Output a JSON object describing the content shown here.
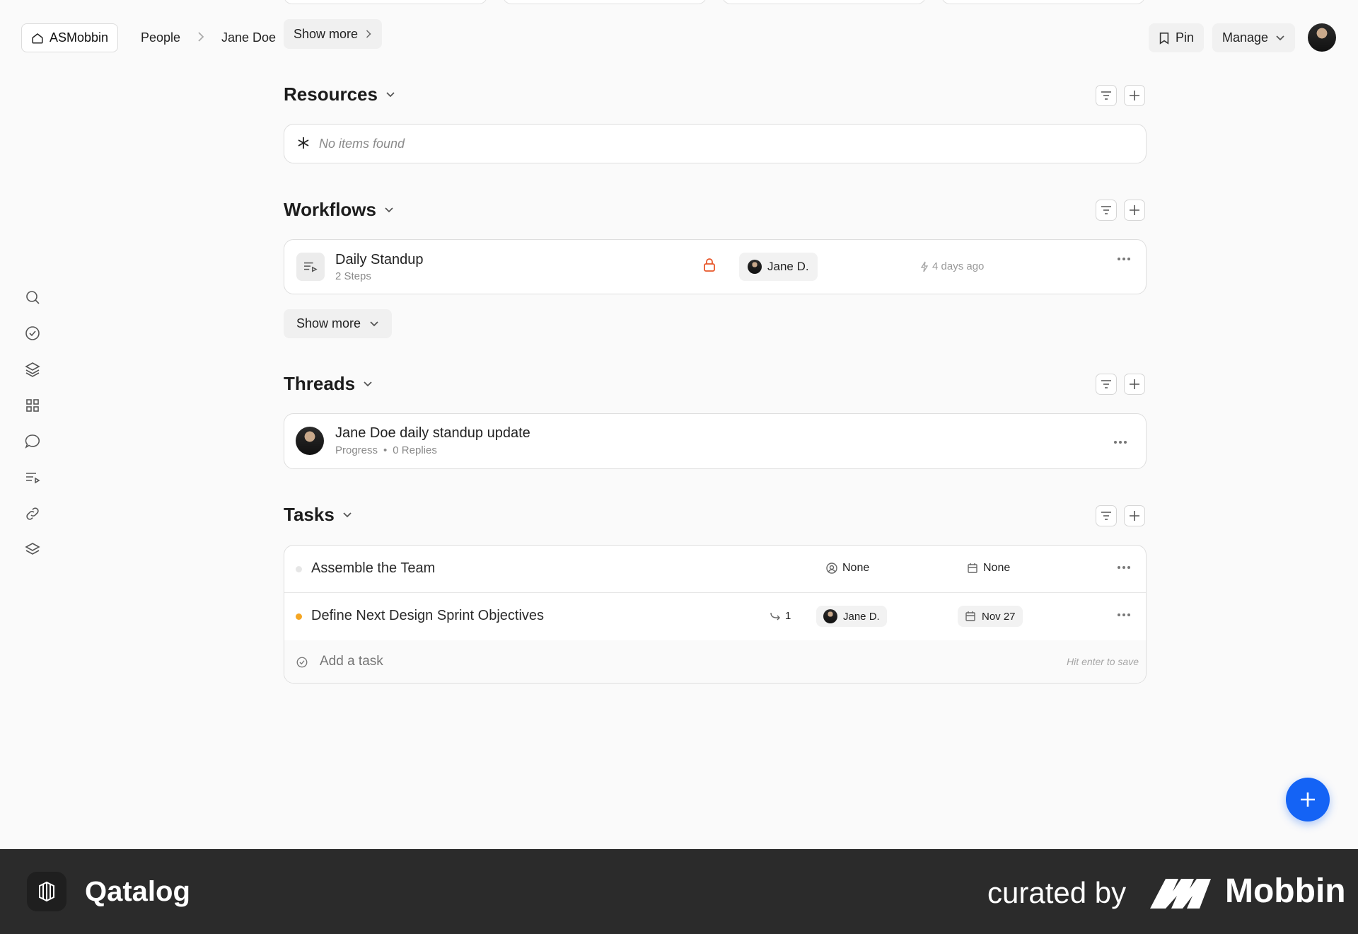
{
  "breadcrumb": {
    "workspace": "ASMobbin",
    "people": "People",
    "person": "Jane Doe",
    "show_more": "Show more"
  },
  "header_actions": {
    "pin": "Pin",
    "manage": "Manage"
  },
  "resources": {
    "title": "Resources",
    "empty": "No items found"
  },
  "workflows": {
    "title": "Workflows",
    "item": {
      "name": "Daily Standup",
      "steps": "2 Steps",
      "assignee": "Jane D.",
      "updated": "4 days ago"
    },
    "show_more": "Show more"
  },
  "threads": {
    "title": "Threads",
    "item": {
      "title": "Jane Doe daily standup update",
      "category": "Progress",
      "sep": "•",
      "replies": "0 Replies"
    }
  },
  "tasks": {
    "title": "Tasks",
    "rows": [
      {
        "name": "Assemble the Team",
        "assignee": "None",
        "due": "None",
        "status_color": "#e6e6e6"
      },
      {
        "name": "Define Next Design Sprint Objectives",
        "subtasks": "1",
        "assignee": "Jane D.",
        "due": "Nov 27",
        "status_color": "#f5a623"
      }
    ],
    "add_placeholder": "Add a task",
    "add_hint": "Hit enter to save"
  },
  "footer": {
    "app_name": "Qatalog",
    "curated_by": "curated by",
    "brand": "Mobbin"
  },
  "colors": {
    "accent": "#1463f5",
    "lock": "#e8572a"
  }
}
